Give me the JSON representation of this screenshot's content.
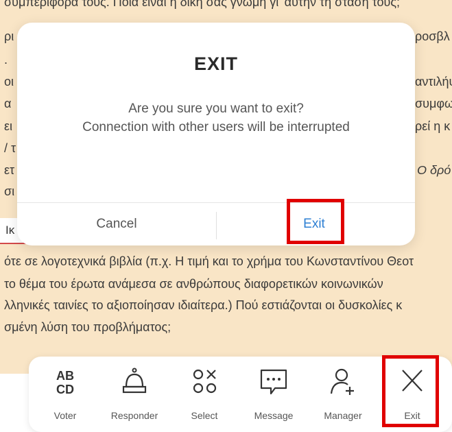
{
  "document": {
    "lines": [
      "συμπεριφορά τους. Ποια είναι η δική σας γνώμη γι' αυτήν τη στάση τους;",
      "ότε σε λογοτεχνικά βιβλία (π.χ. Η τιμή και το χρήμα του Κωνσταντίνου Θεοτ",
      "το θέμα του έρωτα ανάμεσα σε ανθρώπους διαφορετικών κοινωνικών",
      "λληνικές ταινίες το αξιοποίησαν ιδιαίτερα.) Πού εστιάζονται οι δυσκολίες κ",
      "σμένη λύση του προβλήματος;"
    ],
    "left_fragments": [
      "ρι",
      ".",
      "οι",
      "α",
      "ει",
      "/ τ",
      "ετ",
      "σι",
      "σι"
    ],
    "right_fragments": [
      "ροσβλ",
      "αντιλήψ",
      "συμφω",
      "ρεί η κ",
      "Ο δρό"
    ],
    "input_value": "Ικ"
  },
  "dialog": {
    "title": "EXIT",
    "message_line1": "Are you sure you want to exit?",
    "message_line2": "Connection with other users will be interrupted",
    "cancel_label": "Cancel",
    "exit_label": "Exit"
  },
  "toolbar": {
    "items": [
      {
        "label": "Voter",
        "icon": "abcd-icon"
      },
      {
        "label": "Responder",
        "icon": "bell-icon"
      },
      {
        "label": "Select",
        "icon": "shapes-icon"
      },
      {
        "label": "Message",
        "icon": "message-icon"
      },
      {
        "label": "Manager",
        "icon": "add-user-icon"
      },
      {
        "label": "Exit",
        "icon": "close-icon"
      }
    ]
  },
  "colors": {
    "background": "#f9e5c6",
    "accent": "#2d7fd3",
    "highlight": "#e00000"
  }
}
